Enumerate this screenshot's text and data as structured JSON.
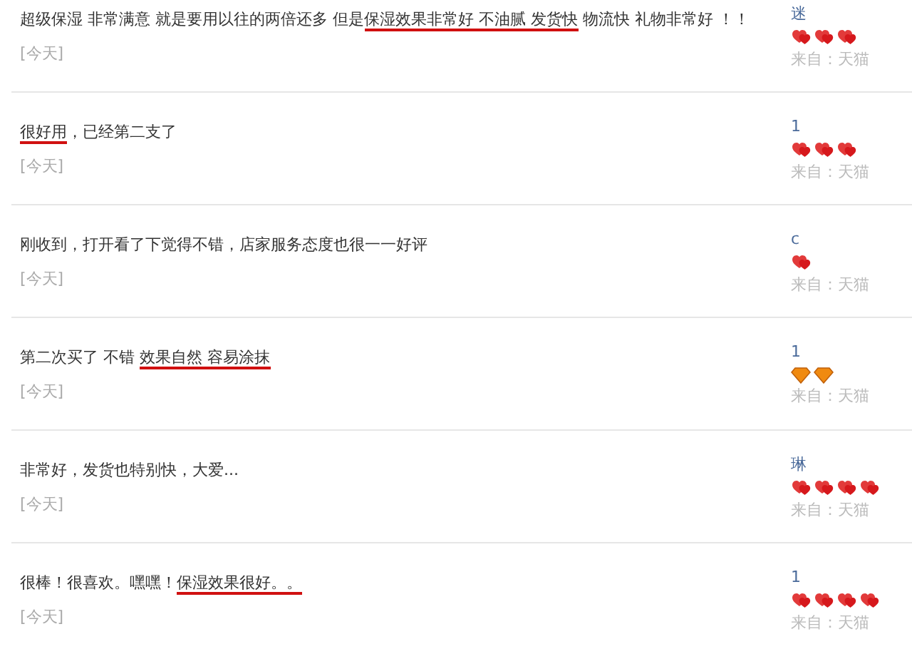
{
  "reviews": [
    {
      "parts": [
        {
          "text": "超级保湿 非常满意 就是要用以往的两倍还多 但是",
          "underlined": false
        },
        {
          "text": "保湿效果非常好 不油腻 发货快",
          "underlined": true
        },
        {
          "text": " 物流快 礼物非常好 ！！",
          "underlined": false
        }
      ],
      "date": "[今天]",
      "user": "迷",
      "badges": [
        {
          "kind": "heart"
        },
        {
          "kind": "heart"
        },
        {
          "kind": "heart"
        }
      ],
      "source": "来自：天猫"
    },
    {
      "parts": [
        {
          "text": "很好用",
          "underlined": true
        },
        {
          "text": "，已经第二支了",
          "underlined": false
        }
      ],
      "date": "[今天]",
      "user": "1",
      "badges": [
        {
          "kind": "heart"
        },
        {
          "kind": "heart"
        },
        {
          "kind": "heart"
        }
      ],
      "source": "来自：天猫"
    },
    {
      "parts": [
        {
          "text": "刚收到，打开看了下觉得不错，店家服务态度也很一一好评",
          "underlined": false
        }
      ],
      "date": "[今天]",
      "user": "c",
      "badges": [
        {
          "kind": "heart"
        }
      ],
      "source": "来自：天猫"
    },
    {
      "parts": [
        {
          "text": "第二次买了  不错  ",
          "underlined": false
        },
        {
          "text": "效果自然  容易涂抹",
          "underlined": true
        }
      ],
      "date": "[今天]",
      "user": "1",
      "badges": [
        {
          "kind": "diamond"
        },
        {
          "kind": "diamond"
        }
      ],
      "source": "来自：天猫"
    },
    {
      "parts": [
        {
          "text": "非常好，发货也特别快，大爱...",
          "underlined": false
        }
      ],
      "date": "[今天]",
      "user": "琳",
      "badges": [
        {
          "kind": "heart"
        },
        {
          "kind": "heart"
        },
        {
          "kind": "heart"
        },
        {
          "kind": "heart"
        }
      ],
      "source": "来自：天猫"
    },
    {
      "parts": [
        {
          "text": "很棒！很喜欢。嘿嘿！",
          "underlined": false
        },
        {
          "text": "保湿效果很好。。",
          "underlined": true
        }
      ],
      "date": "[今天]",
      "user": "1",
      "badges": [
        {
          "kind": "heart"
        },
        {
          "kind": "heart"
        },
        {
          "kind": "heart"
        },
        {
          "kind": "heart"
        }
      ],
      "source": "来自：天猫"
    }
  ]
}
